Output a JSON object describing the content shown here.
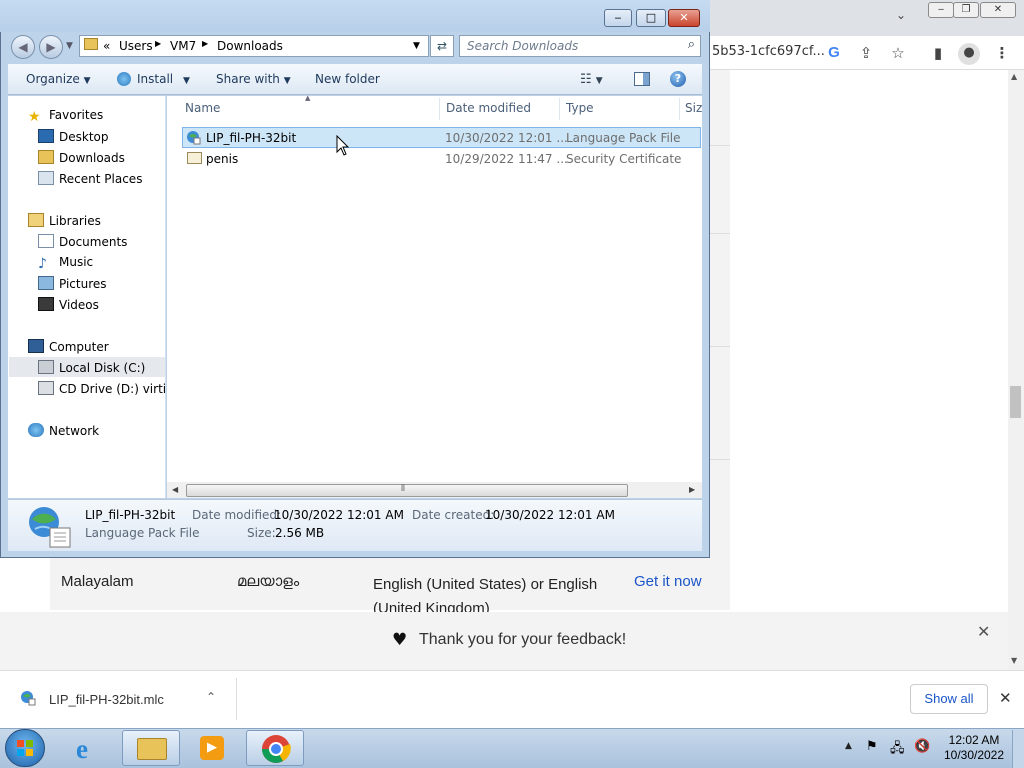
{
  "explorer": {
    "breadcrumb": {
      "overflow": "«",
      "items": [
        "Users",
        "VM7",
        "Downloads"
      ]
    },
    "search_placeholder": "Search Downloads",
    "toolbar": {
      "organize": "Organize",
      "install": "Install",
      "share_with": "Share with",
      "new_folder": "New folder"
    },
    "nav": {
      "favorites": "Favorites",
      "desktop": "Desktop",
      "downloads": "Downloads",
      "recent_places": "Recent Places",
      "libraries": "Libraries",
      "documents": "Documents",
      "music": "Music",
      "pictures": "Pictures",
      "videos": "Videos",
      "computer": "Computer",
      "local_disk": "Local Disk (C:)",
      "cd_drive": "CD Drive (D:) virtio-w",
      "network": "Network"
    },
    "columns": {
      "name": "Name",
      "date_modified": "Date modified",
      "type": "Type",
      "size": "Size"
    },
    "files": [
      {
        "name": "LIP_fil-PH-32bit",
        "date": "10/30/2022 12:01 ...",
        "type": "Language Pack File"
      },
      {
        "name": "penis",
        "date": "10/29/2022 11:47 ...",
        "type": "Security Certificate"
      }
    ],
    "details": {
      "name": "LIP_fil-PH-32bit",
      "type": "Language Pack File",
      "date_modified_label": "Date modified:",
      "date_modified": "10/30/2022 12:01 AM",
      "size_label": "Size:",
      "size": "2.56 MB",
      "date_created_label": "Date created:",
      "date_created": "10/30/2022 12:01 AM"
    }
  },
  "browser": {
    "url_fragment": "5b53-1cfc697cf...",
    "language_row": {
      "language": "Malayalam",
      "native": "മലയാളം",
      "base": "English (United States) or English (United Kingdom)",
      "action": "Get it now"
    },
    "feedback": "Thank you for your feedback!",
    "download": {
      "filename": "LIP_fil-PH-32bit.mlc",
      "show_all": "Show all"
    }
  },
  "taskbar": {
    "time": "12:02 AM",
    "date": "10/30/2022"
  },
  "colors": {
    "selection": "#cde6f7",
    "link": "#1a56c9",
    "taskbar": "#b6cbe2"
  }
}
